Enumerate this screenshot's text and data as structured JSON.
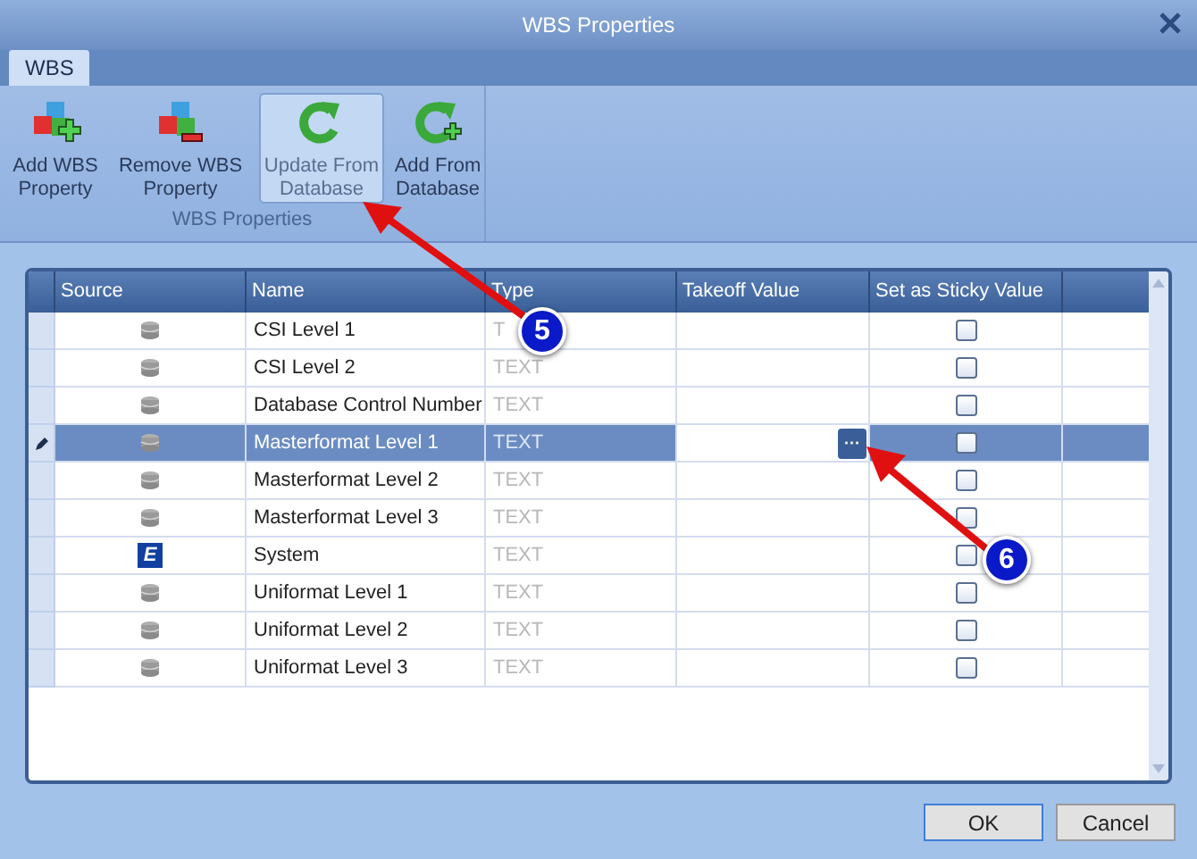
{
  "window": {
    "title": "WBS Properties"
  },
  "tabs": [
    {
      "label": "WBS",
      "selected": true
    }
  ],
  "ribbon": {
    "group_label": "WBS Properties",
    "buttons": [
      {
        "kind": "add",
        "label": "Add WBS Property",
        "selected": false
      },
      {
        "kind": "remove",
        "label": "Remove WBS Property",
        "selected": false
      },
      {
        "kind": "update",
        "label": "Update From Database",
        "selected": true
      },
      {
        "kind": "add_db",
        "label": "Add From Database",
        "selected": false
      }
    ]
  },
  "table": {
    "columns": [
      "Source",
      "Name",
      "Type",
      "Takeoff Value",
      "Set as Sticky Value"
    ],
    "rows": [
      {
        "source": {
          "kind": "database"
        },
        "name": "CSI Level 1",
        "type": "T",
        "checked": false,
        "selected": false
      },
      {
        "source": {
          "kind": "database"
        },
        "name": "CSI Level 2",
        "type": "TEXT",
        "checked": false,
        "selected": false
      },
      {
        "source": {
          "kind": "database"
        },
        "name": "Database Control Number",
        "type": "TEXT",
        "checked": false,
        "selected": false
      },
      {
        "source": {
          "kind": "database"
        },
        "name": "Masterformat Level 1",
        "type": "TEXT",
        "checked": false,
        "selected": true,
        "ellipsis": "···"
      },
      {
        "source": {
          "kind": "database"
        },
        "name": "Masterformat Level 2",
        "type": "TEXT",
        "checked": false,
        "selected": false
      },
      {
        "source": {
          "kind": "database"
        },
        "name": "Masterformat Level 3",
        "type": "TEXT",
        "checked": false,
        "selected": false
      },
      {
        "source": {
          "kind": "system",
          "glyph": "E"
        },
        "name": "System",
        "type": "TEXT",
        "checked": false,
        "selected": false
      },
      {
        "source": {
          "kind": "database"
        },
        "name": "Uniformat Level 1",
        "type": "TEXT",
        "checked": false,
        "selected": false
      },
      {
        "source": {
          "kind": "database"
        },
        "name": "Uniformat Level 2",
        "type": "TEXT",
        "checked": false,
        "selected": false
      },
      {
        "source": {
          "kind": "database"
        },
        "name": "Uniformat Level 3",
        "type": "TEXT",
        "checked": false,
        "selected": false
      }
    ]
  },
  "buttons": [
    "OK",
    "Cancel"
  ],
  "callouts": [
    {
      "label": "5"
    },
    {
      "label": "6"
    }
  ]
}
